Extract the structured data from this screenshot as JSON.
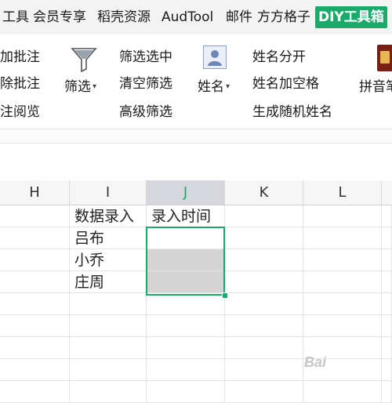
{
  "tabs": [
    {
      "label": "工具"
    },
    {
      "label": "会员专享"
    },
    {
      "label": "稻壳资源"
    },
    {
      "label": "AudTool"
    },
    {
      "label": "邮件"
    },
    {
      "label": "方方格子"
    },
    {
      "label": "DIY工具箱",
      "active": true
    }
  ],
  "ribbon": {
    "batch": [
      "加批注",
      "除批注",
      "注阅览"
    ],
    "filter_button": "筛选",
    "filter_menu": [
      "筛选选中",
      "清空筛选",
      "高级筛选"
    ],
    "name_button": "姓名",
    "name_menu": [
      "姓名分开",
      "姓名加空格",
      "生成随机姓名"
    ],
    "pinyin_button": "拼音笔"
  },
  "sheet": {
    "columns": [
      "H",
      "I",
      "J",
      "K",
      "L"
    ],
    "selected_column": "J",
    "rows": [
      {
        "I": "数据录入",
        "J": "录入时间"
      },
      {
        "I": "吕布",
        "J": ""
      },
      {
        "I": "小乔",
        "J": ""
      },
      {
        "I": "庄周",
        "J": ""
      }
    ]
  },
  "watermark": "Bai"
}
